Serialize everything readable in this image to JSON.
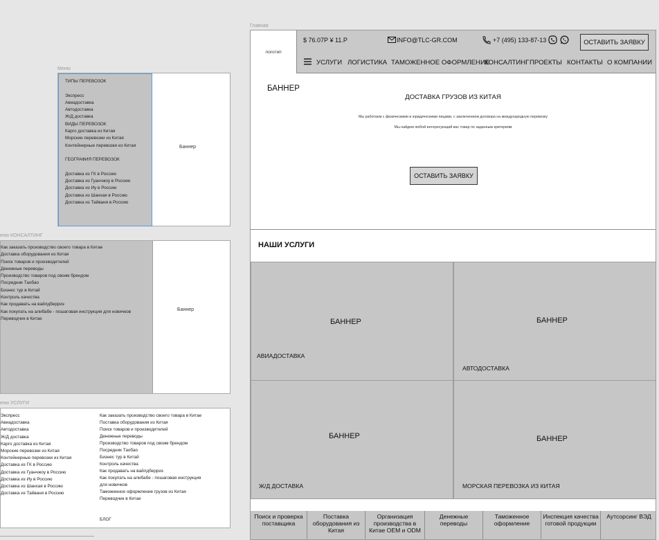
{
  "left": {
    "menu_caption": "Меню",
    "menu_items": [
      "ТИПЫ ПЕРЕВОЗОК",
      "",
      "Экспресс",
      "Авиадоставка",
      "Автодоставка",
      "Ж/Д доставка",
      "ВИДЫ ПЕРЕВОЗОК",
      "Карго доставка из Китая",
      "Морские перевозки из Китая",
      "Контейнерные перевозки из Китая",
      "",
      "ГЕОГРАФИЯ ПЕРЕВОЗОК",
      "",
      "Доставка из ГК в Россию",
      "Доставка из Гуанчжоу в Россию",
      "Доставка из Иу в Россию",
      "Доставка из Шанхая в Россию",
      "Доставка из Тайваня в Россию"
    ],
    "menu_banner": "Баннер",
    "consult_caption": "еню КОНСАЛТИНГ",
    "consult_items": [
      "Как заказать производство своего товара в Китае",
      "Доставка оборудования из Китая",
      "Поиск товаров и производителей",
      "Денежные переводы",
      "Производство товаров под своим брендом",
      "Посредник Таобао",
      "Бизнес тур в Китай",
      "Контроль качества",
      "Как продавать на вайлдберриз",
      "Как покупать на алибабе - пошаговая инструкция для новичков",
      "Переводчик в Китае"
    ],
    "consult_banner": "Баннер",
    "services_caption": "еню УСЛУГИ",
    "services_col1": [
      "Экспресс",
      "Авиадоставка",
      "Автодоставка",
      "Ж/Д доставка",
      "Карго доставка из Китая",
      "Морские перевозки из Китая",
      "Контейнерные перевозки из Китая",
      "Доставка из ГК в Россию",
      "Доставка из Гуанчжоу в Россию",
      "Доставка из Иу в Россию",
      "Доставка из Шанхая в Россию",
      "Доставка из Тайваня в Россию"
    ],
    "services_col2": [
      "Как заказать производство своего товара в Китае",
      "Поставка оборудования из Китая",
      "Поиск товаров и производителей",
      "Денежные переводы",
      "Производство товаров под своим брендом",
      "Посредник Таобао",
      "Бизнес тур в Китай",
      "Контроль качества",
      "Как продавать на вайлдберриз",
      "Как покупать на алибабе - пошаговая инструкция",
      "для новичков",
      "Таможенное оформление грузов из Китая",
      "Переводчик в Китае",
      "",
      "",
      "БЛОГ"
    ]
  },
  "page": {
    "caption": "Главная",
    "logo": "логотип",
    "rates": "$ 76.07Р  ¥ 11.Р",
    "email": "INFO@TLC-GR.COM",
    "phone": "+7 (495) 133-87-13",
    "cta": "ОСТАВИТЬ ЗАЯВКУ",
    "nav": [
      "УСЛУГИ",
      "ЛОГИСТИКА",
      "ТАМОЖЕННОЕ ОФОРМЛЕНИЕ",
      "КОНСАЛТИНГ",
      "ПРОЕКТЫ",
      "КОНТАКТЫ",
      "О КОМПАНИИ"
    ],
    "hero": {
      "banner": "БАННЕР",
      "title": "ДОСТАВКА ГРУЗОВ ИЗ КИТАЯ",
      "text1": "Мы работаем с физическими и юридическими лицами, с заключением договора на международную перевозку",
      "text2": "Мы найдем любой интересующий вас товар по заданным критериям",
      "button": "ОСТАВИТЬ ЗАЯВКУ"
    },
    "services_title": "НАШИ УСЛУГИ",
    "tiles": [
      {
        "banner": "БАННЕР",
        "label": "АВИАДОСТАВКА"
      },
      {
        "banner": "БАННЕР",
        "label": "АВТОДОСТАВКА"
      },
      {
        "banner": "БАННЕР",
        "label": "Ж/Д ДОСТАВКА"
      },
      {
        "banner": "БАННЕР",
        "label": "МОРСКАЯ ПЕРЕВОЗКА ИЗ КИТАЯ"
      }
    ],
    "bottom": [
      "Поиск и проверка поставщика",
      "Поставка оборудования из Китая",
      "Организация производства в Китае OEM и ODM",
      "Денежные переводы",
      "Таможенное оформление",
      "Инспекция качества готовой продукции",
      "Аутсорсинг ВЭД"
    ]
  }
}
